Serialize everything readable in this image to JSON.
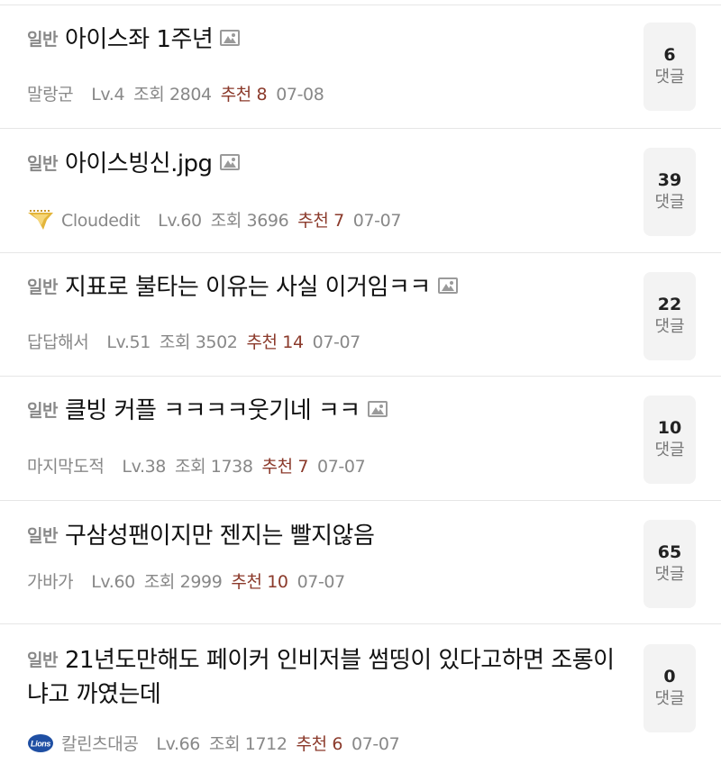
{
  "posts": [
    {
      "category": "일반",
      "title": "아이스좌 1주년",
      "has_image": true,
      "author": "말랑군",
      "level": "Lv.4",
      "views": "조회 2804",
      "recommend": "추천 8",
      "date": "07-08",
      "comments": "6",
      "comment_label": "댓글",
      "avatar": null
    },
    {
      "category": "일반",
      "title": "아이스빙신.jpg",
      "has_image": true,
      "author": "Cloudedit",
      "level": "Lv.60",
      "views": "조회 3696",
      "recommend": "추천 7",
      "date": "07-07",
      "comments": "39",
      "comment_label": "댓글",
      "avatar": "emblem-icon"
    },
    {
      "category": "일반",
      "title": "지표로 불타는 이유는 사실 이거임ㅋㅋ",
      "has_image": true,
      "author": "답답해서",
      "level": "Lv.51",
      "views": "조회 3502",
      "recommend": "추천 14",
      "date": "07-07",
      "comments": "22",
      "comment_label": "댓글",
      "avatar": null
    },
    {
      "category": "일반",
      "title": "클빙 커플 ㅋㅋㅋㅋ웃기네 ㅋㅋ",
      "has_image": true,
      "author": "마지막도적",
      "level": "Lv.38",
      "views": "조회 1738",
      "recommend": "추천 7",
      "date": "07-07",
      "comments": "10",
      "comment_label": "댓글",
      "avatar": null
    },
    {
      "category": "일반",
      "title": "구삼성팬이지만 젠지는 빨지않음",
      "has_image": false,
      "author": "가바가",
      "level": "Lv.60",
      "views": "조회 2999",
      "recommend": "추천 10",
      "date": "07-07",
      "comments": "65",
      "comment_label": "댓글",
      "avatar": null
    },
    {
      "category": "일반",
      "title": "21년도만해도 페이커 인비저블 썸띵이 있다고하면 조롱이냐고 까였는데",
      "has_image": false,
      "author": "칼린츠대공",
      "level": "Lv.66",
      "views": "조회 1712",
      "recommend": "추천 6",
      "date": "07-07",
      "comments": "0",
      "comment_label": "댓글",
      "avatar": "team-logo-icon",
      "avatar_text": "Lions"
    }
  ],
  "colors": {
    "recommend": "#8b3a2b",
    "meta": "#888888",
    "divider": "#e6e6e6",
    "comment_box": "#f3f3f3"
  }
}
